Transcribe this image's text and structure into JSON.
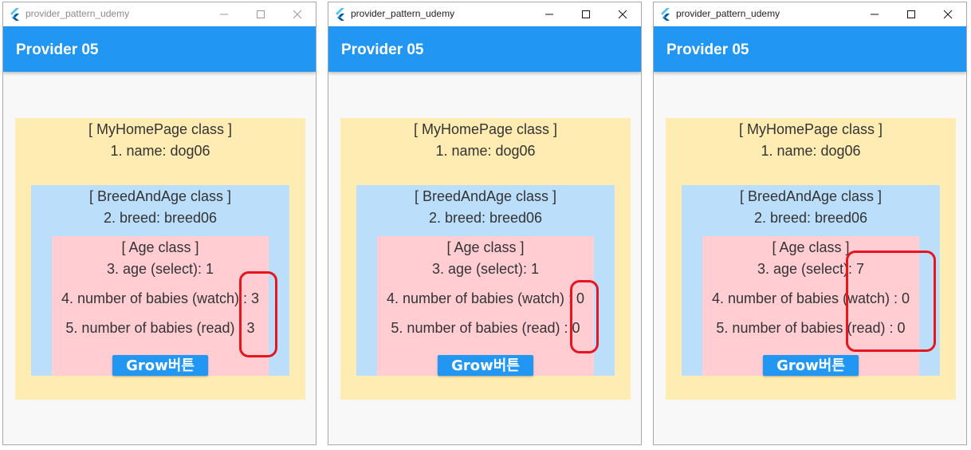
{
  "windows": [
    {
      "title": "provider_pattern_udemy",
      "state": "inactive",
      "appbar_title": "Provider 05",
      "outer": {
        "heading": "[ MyHomePage class ]",
        "name_line": "1. name: dog06"
      },
      "middle": {
        "heading": "[ BreedAndAge class ]",
        "breed_line": "2. breed: breed06"
      },
      "inner": {
        "heading": "[ Age class ]",
        "age_line": "3. age (select): 1",
        "watch_line": "4. number of babies (watch) : 3",
        "read_line": "5. number of babies (read) : 3"
      },
      "button_label": "Grow버튼"
    },
    {
      "title": "provider_pattern_udemy",
      "state": "active",
      "appbar_title": "Provider 05",
      "outer": {
        "heading": "[ MyHomePage class ]",
        "name_line": "1. name: dog06"
      },
      "middle": {
        "heading": "[ BreedAndAge class ]",
        "breed_line": "2. breed: breed06"
      },
      "inner": {
        "heading": "[ Age class ]",
        "age_line": "3. age (select): 1",
        "watch_line": "4. number of babies (watch) : 0",
        "read_line": "5. number of babies (read) : 0"
      },
      "button_label": "Grow버튼"
    },
    {
      "title": "provider_pattern_udemy",
      "state": "active",
      "appbar_title": "Provider 05",
      "outer": {
        "heading": "[ MyHomePage class ]",
        "name_line": "1. name: dog06"
      },
      "middle": {
        "heading": "[ BreedAndAge class ]",
        "breed_line": "2. breed: breed06"
      },
      "inner": {
        "heading": "[ Age class ]",
        "age_line": "3. age (select): 7",
        "watch_line": "4. number of babies (watch) : 0",
        "read_line": "5. number of babies (read) : 0"
      },
      "button_label": "Grow버튼"
    }
  ],
  "colors": {
    "appbar": "#2196f3",
    "outer_box": "#ffecb3",
    "middle_box": "#bbdefb",
    "inner_box": "#ffcdd2",
    "highlight": "#e8141e"
  },
  "icons": {
    "app": "flutter-icon",
    "minimize": "minimize-icon",
    "maximize": "maximize-icon",
    "close": "close-icon"
  }
}
